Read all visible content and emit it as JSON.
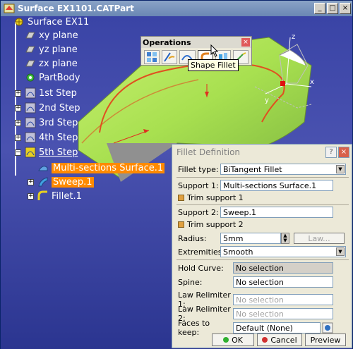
{
  "window": {
    "title": "Surface EX1101.CATPart"
  },
  "tree": {
    "root": "Surface EX11",
    "items": [
      {
        "label": "xy plane"
      },
      {
        "label": "yz plane"
      },
      {
        "label": "zx plane"
      },
      {
        "label": "PartBody"
      },
      {
        "label": "1st Step"
      },
      {
        "label": "2nd Step"
      },
      {
        "label": "3rd Step"
      },
      {
        "label": "4th Step"
      },
      {
        "label": "5th Step"
      },
      {
        "label": "Multi-sections Surface.1"
      },
      {
        "label": "Sweep.1"
      },
      {
        "label": "Fillet.1"
      }
    ]
  },
  "operations": {
    "title": "Operations",
    "tooltip": "Shape Fillet"
  },
  "dialog": {
    "title": "Fillet Definition",
    "fillet_type_label": "Fillet type:",
    "fillet_type_value": "BiTangent Fillet",
    "support1_label": "Support 1:",
    "support1_value": "Multi-sections Surface.1",
    "trim1_label": "Trim support 1",
    "support2_label": "Support 2:",
    "support2_value": "Sweep.1",
    "trim2_label": "Trim support 2",
    "radius_label": "Radius:",
    "radius_value": "5mm",
    "law_label": "Law...",
    "extremities_label": "Extremities:",
    "extremities_value": "Smooth",
    "hold_curve_label": "Hold Curve:",
    "hold_curve_value": "No selection",
    "spine_label": "Spine:",
    "spine_value": "No selection",
    "law_relimiter1_label": "Law Relimiter 1:",
    "law_relimiter1_value": "No selection",
    "law_relimiter2_label": "Law Relimiter 2:",
    "law_relimiter2_value": "No selection",
    "faces_label": "Faces to keep:",
    "faces_value": "Default (None)",
    "ok_label": "OK",
    "cancel_label": "Cancel",
    "preview_label": "Preview"
  }
}
